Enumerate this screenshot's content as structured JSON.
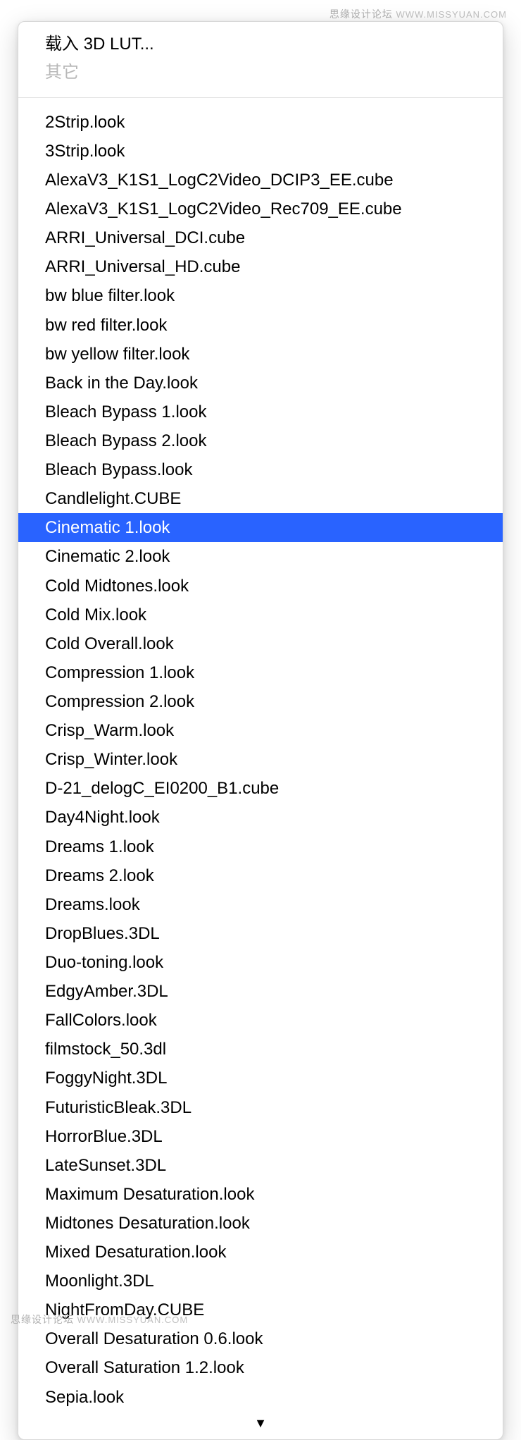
{
  "watermark": {
    "top_chinese": "思缘设计论坛",
    "top_url": "WWW.MISSYUAN.COM",
    "bottom_chinese": "思缘设计论坛",
    "bottom_url": "WWW.MISSYUAN.COM"
  },
  "dropdown": {
    "header": {
      "load_label": "载入 3D LUT...",
      "other_label": "其它"
    },
    "selected_index": 14,
    "items": [
      "2Strip.look",
      "3Strip.look",
      "AlexaV3_K1S1_LogC2Video_DCIP3_EE.cube",
      "AlexaV3_K1S1_LogC2Video_Rec709_EE.cube",
      "ARRI_Universal_DCI.cube",
      "ARRI_Universal_HD.cube",
      "bw blue filter.look",
      "bw red filter.look",
      "bw yellow filter.look",
      "Back in the Day.look",
      "Bleach Bypass 1.look",
      "Bleach Bypass 2.look",
      "Bleach Bypass.look",
      "Candlelight.CUBE",
      "Cinematic 1.look",
      "Cinematic 2.look",
      "Cold Midtones.look",
      "Cold Mix.look",
      "Cold Overall.look",
      "Compression 1.look",
      "Compression 2.look",
      "Crisp_Warm.look",
      "Crisp_Winter.look",
      "D-21_delogC_EI0200_B1.cube",
      "Day4Night.look",
      "Dreams 1.look",
      "Dreams 2.look",
      "Dreams.look",
      "DropBlues.3DL",
      "Duo-toning.look",
      "EdgyAmber.3DL",
      "FallColors.look",
      "filmstock_50.3dl",
      "FoggyNight.3DL",
      "FuturisticBleak.3DL",
      "HorrorBlue.3DL",
      "LateSunset.3DL",
      "Maximum Desaturation.look",
      "Midtones Desaturation.look",
      "Mixed Desaturation.look",
      "Moonlight.3DL",
      "NightFromDay.CUBE",
      "Overall Desaturation 0.6.look",
      "Overall Saturation 1.2.look",
      "Sepia.look"
    ],
    "scroll_indicator": "▼"
  }
}
